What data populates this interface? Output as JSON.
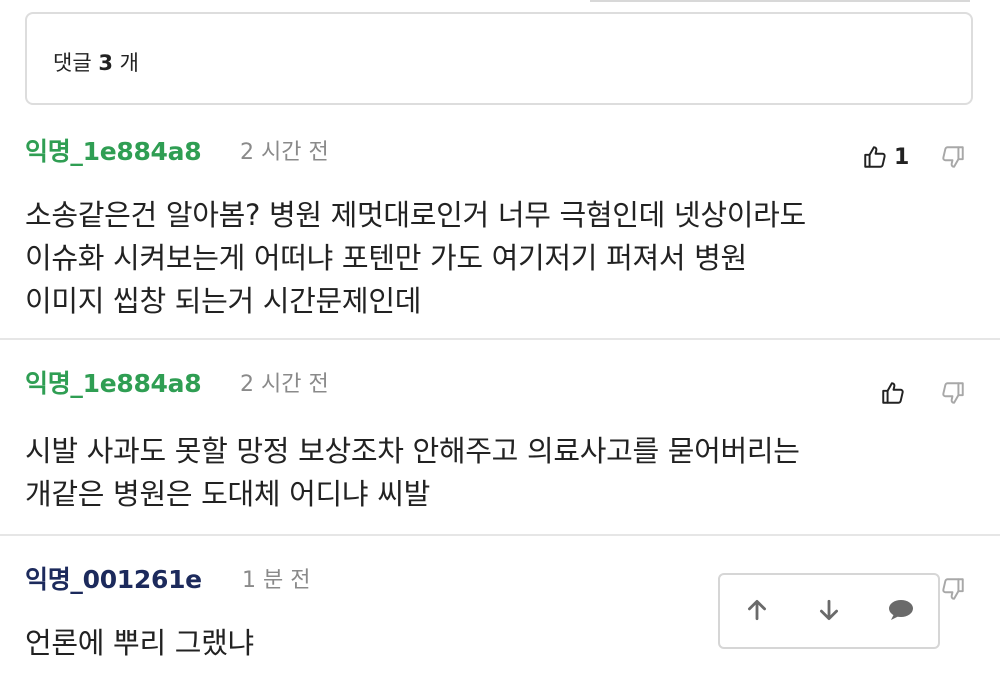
{
  "comment_count": {
    "prefix": "댓글",
    "count": "3",
    "suffix": "개"
  },
  "comments": [
    {
      "author": "익명_1e884a8",
      "time": "2 시간 전",
      "lines": [
        "소송같은건 알아봄? 병원 제멋대로인거 너무 극혐인데 넷상이라도",
        "이슈화 시켜보는게 어떠냐 포텐만 가도 여기저기 퍼져서 병원",
        "이미지 씹창 되는거 시간문제인데"
      ],
      "like_count": "1",
      "author_color": "#2f9e53"
    },
    {
      "author": "익명_1e884a8",
      "time": "2 시간 전",
      "lines": [
        "시발 사과도 못할 망정 보상조차 안해주고 의료사고를 묻어버리는",
        "개같은 병원은 도대체 어디냐 씨발"
      ],
      "like_count": "",
      "author_color": "#2f9e53"
    },
    {
      "author": "익명_001261e",
      "time": "1 분 전",
      "lines": [
        "언론에 뿌리 그랬냐"
      ],
      "like_count": "",
      "author_color": "#1c2a5c"
    }
  ],
  "icons": {
    "like": "thumbs-up-icon",
    "dislike": "thumbs-down-icon",
    "upvote": "arrow-up-icon",
    "downvote": "arrow-down-icon",
    "reply": "speech-bubble-icon"
  }
}
